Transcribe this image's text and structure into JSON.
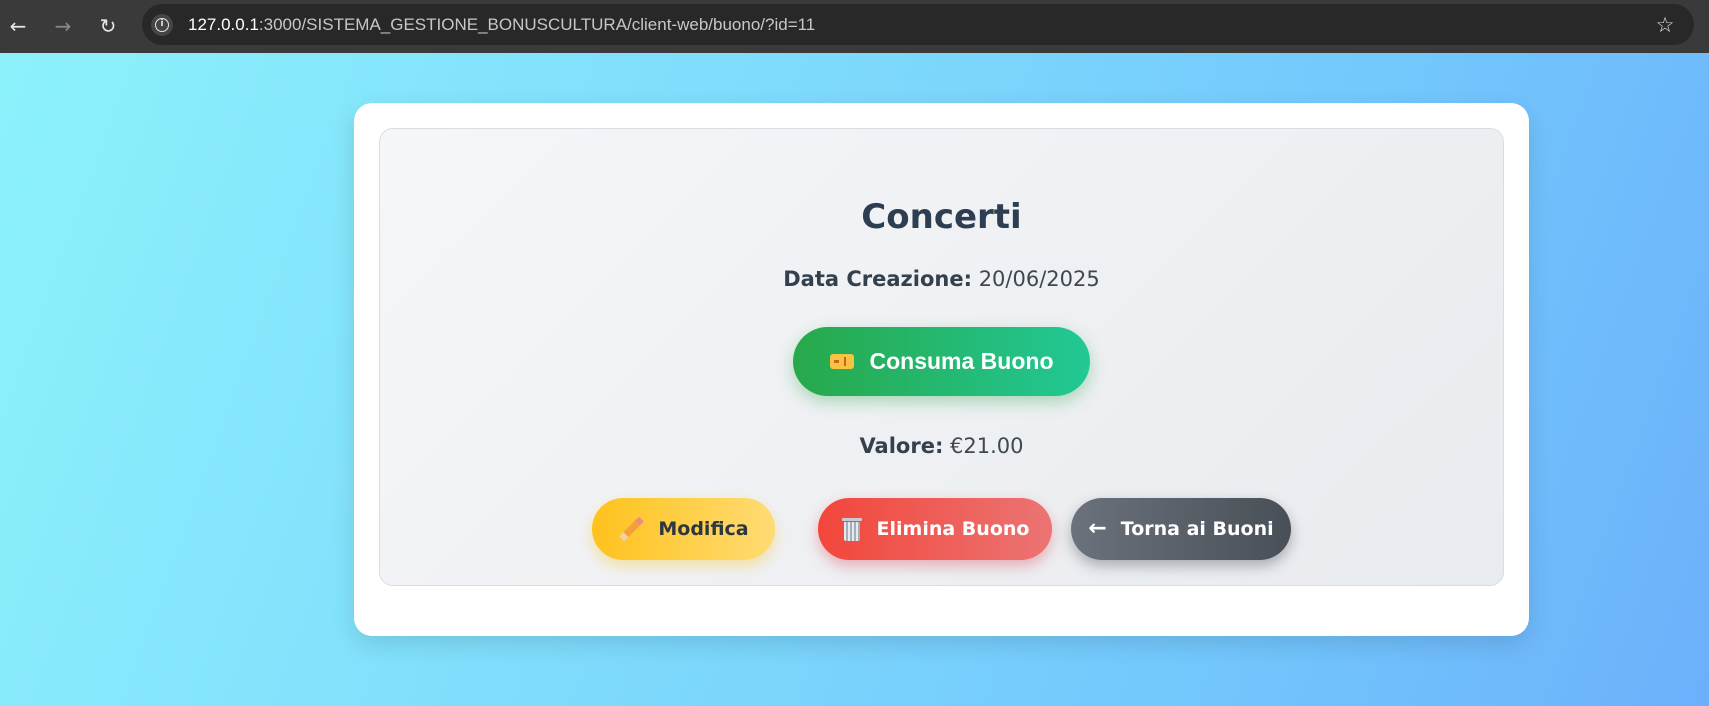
{
  "browser": {
    "back_icon": "arrow-left-icon",
    "forward_icon": "arrow-right-icon",
    "reload_icon": "reload-icon",
    "info_icon": "info-icon",
    "url_host": "127.0.0.1",
    "url_rest": ":3000/SISTEMA_GESTIONE_BONUSCULTURA/client-web/buono/?id=11",
    "bookmark_icon": "star-icon"
  },
  "voucher": {
    "title": "Concerti",
    "date_label": "Data Creazione:",
    "date_value": "20/06/2025",
    "consume_label": "Consuma Buono",
    "value_label": "Valore:",
    "value_amount": "€21.00"
  },
  "actions": {
    "edit_label": "Modifica",
    "delete_label": "Elimina Buono",
    "back_label": "Torna ai Buoni",
    "back_arrow": "←"
  },
  "colors": {
    "consume": "#27a84a",
    "edit": "#fec21c",
    "delete": "#f2463b",
    "back": "#6b727b",
    "title": "#2c3e50"
  }
}
